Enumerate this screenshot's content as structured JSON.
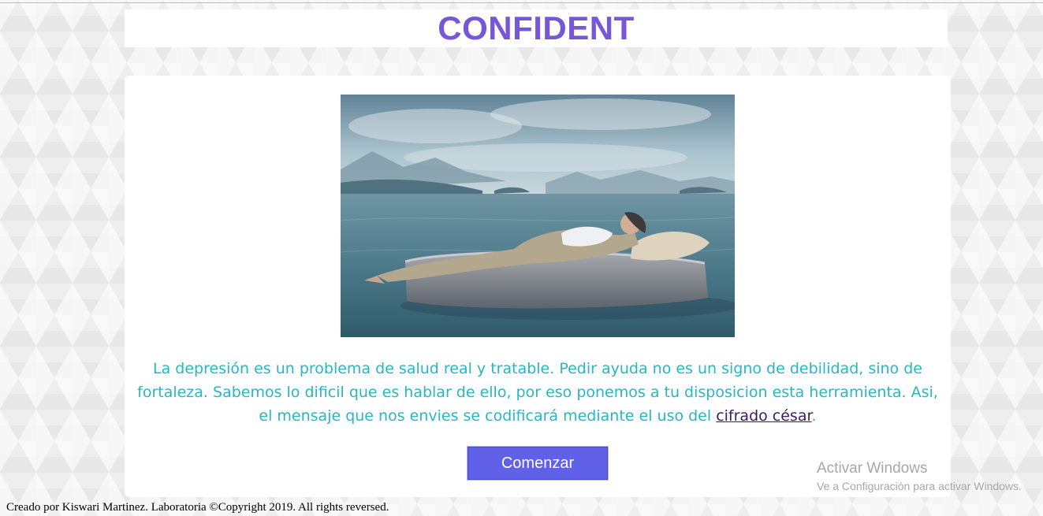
{
  "header": {
    "brand": "CONFIDENT"
  },
  "hero": {
    "icon": "hero-image",
    "description_visible": false
  },
  "intro": {
    "text_before_link": "La depresión es un problema de salud real y tratable. Pedir ayuda no es un signo de debilidad, sino de fortaleza. Sabemos lo dificil que es hablar de ello, por eso ponemos a tu disposicion esta herramienta. Asi, el mensaje que nos envies se codificará mediante el uso del ",
    "link_label": "cifrado césar",
    "text_after_link": "."
  },
  "actions": {
    "start_label": "Comenzar"
  },
  "footer": {
    "text": "Creado por Kiswari Martinez. Laboratoria ©Copyright 2019. All rights reversed."
  },
  "os_watermark": {
    "title": "Activar Windows",
    "subtitle": "Ve a Configuración para activar Windows."
  },
  "colors": {
    "brand": "#7557d8",
    "intro_text": "#29b6c4",
    "link": "#3b1b5e",
    "button_bg": "#6060e8"
  }
}
